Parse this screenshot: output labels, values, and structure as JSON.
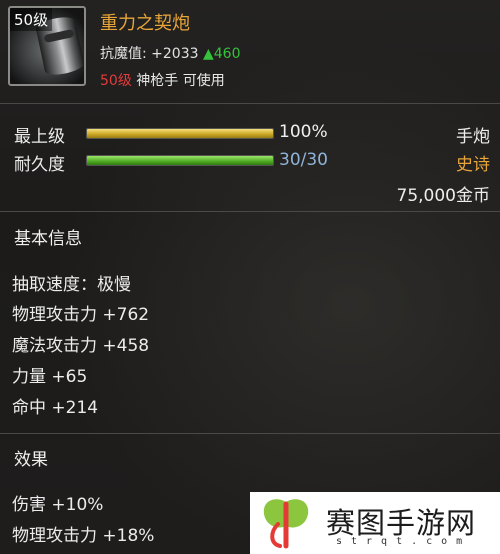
{
  "item": {
    "level_badge": "50级",
    "name": "重力之契炮",
    "stat_label": "抗魔值:",
    "stat_value": "+2033",
    "stat_increase": "▲460",
    "req_level": "50级",
    "req_text": "神枪手 可使用"
  },
  "bars": {
    "grade": {
      "label": "最上级",
      "value_text": "100%",
      "fill": 1.0
    },
    "durability": {
      "label": "耐久度",
      "value_text": "30/30",
      "fill": 1.0
    }
  },
  "side": {
    "weapon_type": "手炮",
    "rarity": "史诗",
    "price": "75,000金币"
  },
  "basic_info": {
    "title": "基本信息",
    "attrs": [
      "抽取速度：极慢",
      "物理攻击力 +762",
      "魔法攻击力 +458",
      "力量 +65",
      "命中 +214"
    ]
  },
  "effects": {
    "title": "效果",
    "attrs": [
      "伤害 +10%",
      "物理攻击力 +18%"
    ]
  },
  "watermark": {
    "text": "赛图手游网",
    "sub": "strqt.com"
  },
  "colors": {
    "item_name": "#e9a638",
    "increase": "#36c23b",
    "req_level": "#e23b3b",
    "rarity": "#e9a638",
    "durability_value": "#8fb4d8"
  }
}
